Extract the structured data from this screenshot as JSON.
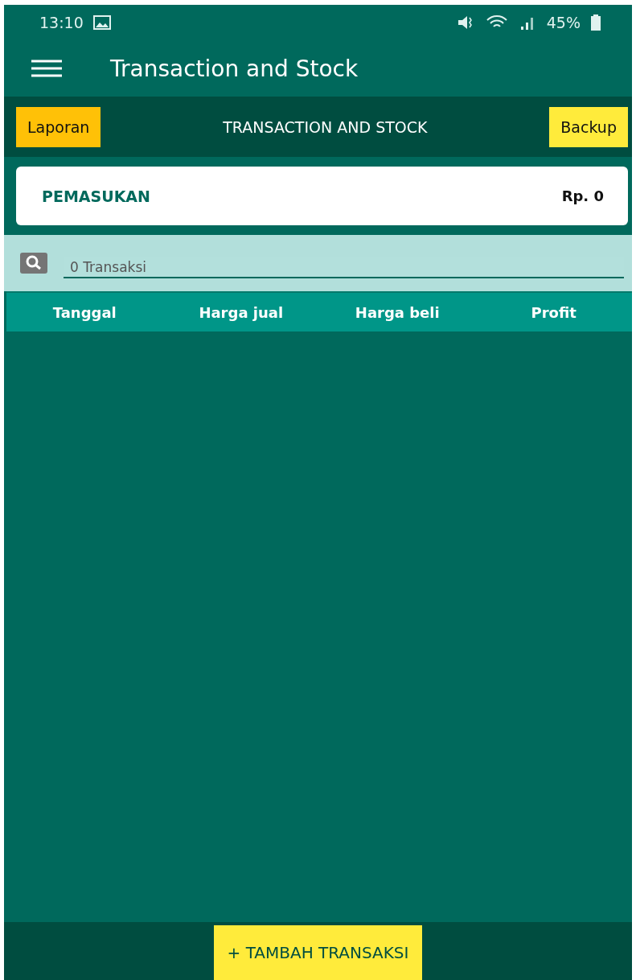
{
  "status_bar": {
    "time": "13:10",
    "battery": "45%"
  },
  "app_bar": {
    "title": "Transaction and Stock"
  },
  "toolbar": {
    "left_button": "Laporan",
    "title": "TRANSACTION AND STOCK",
    "right_button": "Backup"
  },
  "income_card": {
    "label": "PEMASUKAN",
    "value": "Rp. 0"
  },
  "search": {
    "placeholder": "0 Transaksi"
  },
  "table": {
    "columns": [
      "Tanggal",
      "Harga jual",
      "Harga beli",
      "Profit"
    ]
  },
  "add_button": "+ TAMBAH TRANSAKSI"
}
